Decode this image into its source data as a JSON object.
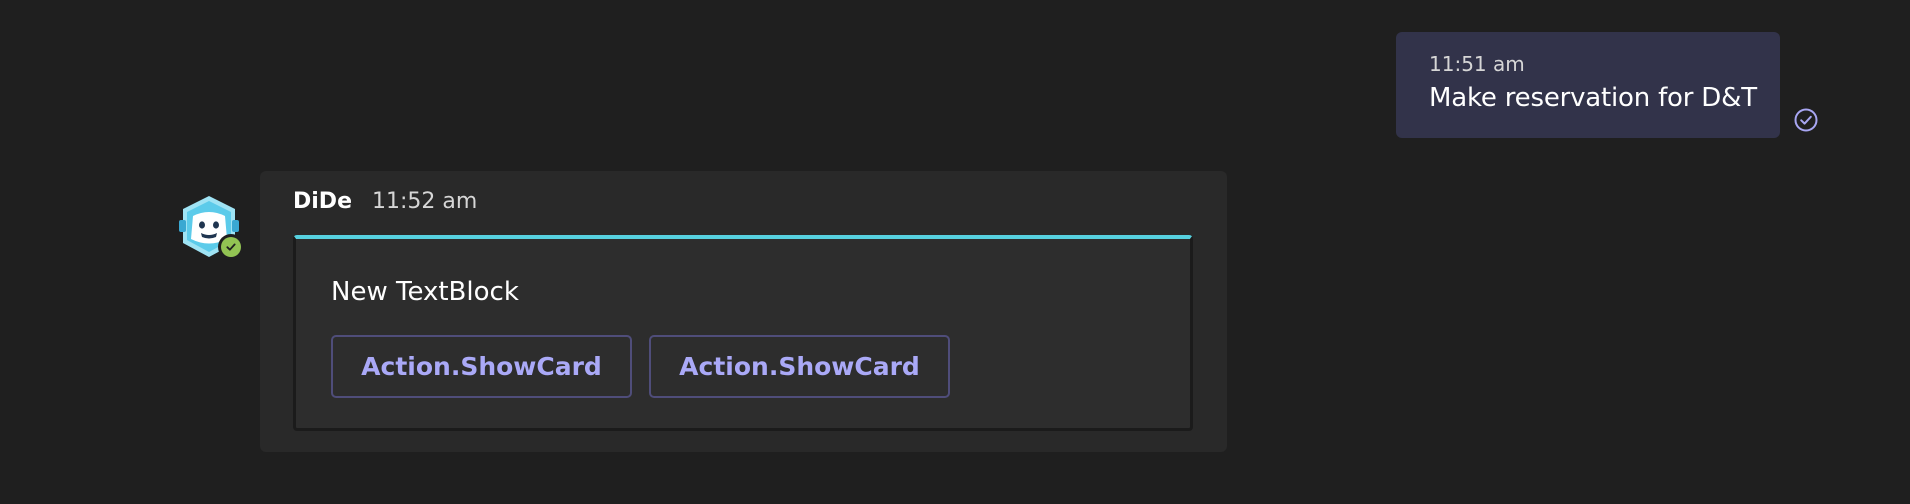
{
  "outgoing_message": {
    "time": "11:51 am",
    "text": "Make reservation for D&T",
    "status_icon": "read-check-icon"
  },
  "bot_message": {
    "sender": "DiDe",
    "time": "11:52 am",
    "avatar_icon": "bot-avatar-icon",
    "presence_icon": "available-check-icon",
    "card": {
      "text": "New TextBlock",
      "actions": [
        {
          "label": "Action.ShowCard"
        },
        {
          "label": "Action.ShowCard"
        }
      ]
    }
  },
  "colors": {
    "background": "#1f1f1f",
    "outgoing_bubble": "#32334a",
    "incoming_bubble": "#292929",
    "card_accent": "#56d1df",
    "action_text": "#aaa9f7",
    "presence_available": "#92c353"
  }
}
